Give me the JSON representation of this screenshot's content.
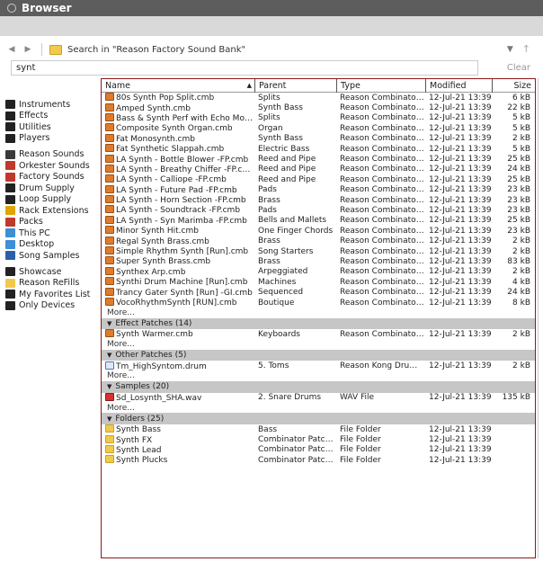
{
  "window": {
    "title": "Browser"
  },
  "nav": {
    "back_icon": "triangle-left-icon",
    "forward_icon": "triangle-right-icon",
    "search_scope": "Search in \"Reason Factory Sound Bank\"",
    "dropdown_icon": "triangle-down-icon",
    "up_icon": "arrow-up-icon"
  },
  "search": {
    "value": "synt",
    "clear_label": "Clear"
  },
  "sidebar": {
    "groups": [
      [
        {
          "label": "Instruments",
          "icon": "instruments-icon",
          "color": "#222222"
        },
        {
          "label": "Effects",
          "icon": "effects-icon",
          "color": "#222222"
        },
        {
          "label": "Utilities",
          "icon": "utilities-icon",
          "color": "#222222"
        },
        {
          "label": "Players",
          "icon": "players-icon",
          "color": "#222222"
        }
      ],
      [
        {
          "label": "Reason Sounds",
          "icon": "reason-sounds-icon",
          "color": "#3a3a3a"
        },
        {
          "label": "Orkester Sounds",
          "icon": "orkester-sounds-icon",
          "color": "#c0392b"
        },
        {
          "label": "Factory Sounds",
          "icon": "factory-sounds-icon",
          "color": "#c0392b"
        },
        {
          "label": "Drum Supply",
          "icon": "drum-supply-icon",
          "color": "#222222"
        },
        {
          "label": "Loop Supply",
          "icon": "loop-supply-icon",
          "color": "#222222"
        },
        {
          "label": "Rack Extensions",
          "icon": "rack-extensions-icon",
          "color": "#e0a400"
        },
        {
          "label": "Packs",
          "icon": "packs-icon",
          "color": "#c0392b"
        },
        {
          "label": "This PC",
          "icon": "this-pc-icon",
          "color": "#3d8fd6"
        },
        {
          "label": "Desktop",
          "icon": "desktop-icon",
          "color": "#3d8fd6"
        },
        {
          "label": "Song Samples",
          "icon": "song-samples-icon",
          "color": "#2b5fa8"
        }
      ],
      [
        {
          "label": "Showcase",
          "icon": "star-icon",
          "color": "#222222"
        },
        {
          "label": "Reason ReFills",
          "icon": "folder-icon",
          "color": "#f2c94c"
        },
        {
          "label": "My Favorites List",
          "icon": "star-icon",
          "color": "#222222"
        },
        {
          "label": "Only Devices",
          "icon": "star-icon",
          "color": "#222222"
        }
      ]
    ]
  },
  "columns": {
    "name": "Name",
    "parent": "Parent",
    "type": "Type",
    "modified": "Modified",
    "size": "Size"
  },
  "sections": [
    {
      "header": "",
      "rows": [
        {
          "icon": "comb",
          "name": "80s Synth Pop Split.cmb",
          "parent": "Splits",
          "type": "Reason Combinator ...",
          "modified": "12-Jul-21 13:39",
          "size": "6 kB"
        },
        {
          "icon": "comb",
          "name": "Amped Synth.cmb",
          "parent": "Synth Bass",
          "type": "Reason Combinator ...",
          "modified": "12-Jul-21 13:39",
          "size": "22 kB"
        },
        {
          "icon": "comb",
          "name": "Bass & Synth Perf with Echo Mod [...",
          "parent": "Splits",
          "type": "Reason Combinator ...",
          "modified": "12-Jul-21 13:39",
          "size": "5 kB"
        },
        {
          "icon": "comb",
          "name": "Composite Synth Organ.cmb",
          "parent": "Organ",
          "type": "Reason Combinator ...",
          "modified": "12-Jul-21 13:39",
          "size": "5 kB"
        },
        {
          "icon": "comb",
          "name": "Fat Monosynth.cmb",
          "parent": "Synth Bass",
          "type": "Reason Combinator ...",
          "modified": "12-Jul-21 13:39",
          "size": "2 kB"
        },
        {
          "icon": "comb",
          "name": "Fat Synthetic Slappah.cmb",
          "parent": "Electric Bass",
          "type": "Reason Combinator ...",
          "modified": "12-Jul-21 13:39",
          "size": "5 kB"
        },
        {
          "icon": "comb",
          "name": "LA Synth - Bottle Blower  -FP.cmb",
          "parent": "Reed and Pipe",
          "type": "Reason Combinator ...",
          "modified": "12-Jul-21 13:39",
          "size": "25 kB"
        },
        {
          "icon": "comb",
          "name": "LA Synth - Breathy Chiffer  -FP.cmb",
          "parent": "Reed and Pipe",
          "type": "Reason Combinator ...",
          "modified": "12-Jul-21 13:39",
          "size": "24 kB"
        },
        {
          "icon": "comb",
          "name": "LA Synth - Calliope  -FP.cmb",
          "parent": "Reed and Pipe",
          "type": "Reason Combinator ...",
          "modified": "12-Jul-21 13:39",
          "size": "25 kB"
        },
        {
          "icon": "comb",
          "name": "LA Synth - Future Pad  -FP.cmb",
          "parent": "Pads",
          "type": "Reason Combinator ...",
          "modified": "12-Jul-21 13:39",
          "size": "23 kB"
        },
        {
          "icon": "comb",
          "name": "LA Synth - Horn Section  -FP.cmb",
          "parent": "Brass",
          "type": "Reason Combinator ...",
          "modified": "12-Jul-21 13:39",
          "size": "23 kB"
        },
        {
          "icon": "comb",
          "name": "LA Synth - Soundtrack  -FP.cmb",
          "parent": "Pads",
          "type": "Reason Combinator ...",
          "modified": "12-Jul-21 13:39",
          "size": "23 kB"
        },
        {
          "icon": "comb",
          "name": "LA Synth - Syn Marimba  -FP.cmb",
          "parent": "Bells and Mallets",
          "type": "Reason Combinator ...",
          "modified": "12-Jul-21 13:39",
          "size": "25 kB"
        },
        {
          "icon": "comb",
          "name": "Minor Synth Hit.cmb",
          "parent": "One Finger Chords",
          "type": "Reason Combinator ...",
          "modified": "12-Jul-21 13:39",
          "size": "23 kB"
        },
        {
          "icon": "comb",
          "name": "Regal Synth Brass.cmb",
          "parent": "Brass",
          "type": "Reason Combinator ...",
          "modified": "12-Jul-21 13:39",
          "size": "2 kB"
        },
        {
          "icon": "comb",
          "name": "Simple Rhythm Synth [Run].cmb",
          "parent": "Song Starters",
          "type": "Reason Combinator ...",
          "modified": "12-Jul-21 13:39",
          "size": "2 kB"
        },
        {
          "icon": "comb",
          "name": "Super Synth Brass.cmb",
          "parent": "Brass",
          "type": "Reason Combinator ...",
          "modified": "12-Jul-21 13:39",
          "size": "83 kB"
        },
        {
          "icon": "comb",
          "name": "Synthex Arp.cmb",
          "parent": "Arpeggiated",
          "type": "Reason Combinator ...",
          "modified": "12-Jul-21 13:39",
          "size": "2 kB"
        },
        {
          "icon": "comb",
          "name": "Synthi Drum Machine [Run].cmb",
          "parent": "Machines",
          "type": "Reason Combinator ...",
          "modified": "12-Jul-21 13:39",
          "size": "4 kB"
        },
        {
          "icon": "comb",
          "name": "Trancy Gater Synth [Run]  -GI.cmb",
          "parent": "Sequenced",
          "type": "Reason Combinator ...",
          "modified": "12-Jul-21 13:39",
          "size": "24 kB"
        },
        {
          "icon": "comb",
          "name": "VocoRhythmSynth [RUN].cmb",
          "parent": "Boutique",
          "type": "Reason Combinator ...",
          "modified": "12-Jul-21 13:39",
          "size": "8 kB"
        }
      ],
      "more": "More..."
    },
    {
      "header": "Effect Patches (14)",
      "rows": [
        {
          "icon": "comb",
          "name": "Synth Warmer.cmb",
          "parent": "Keyboards",
          "type": "Reason Combinator ...",
          "modified": "12-Jul-21 13:39",
          "size": "2 kB"
        }
      ],
      "more": "More..."
    },
    {
      "header": "Other Patches (5)",
      "rows": [
        {
          "icon": "drum",
          "name": "Tm_HighSyntom.drum",
          "parent": "5. Toms",
          "type": "Reason Kong Drum ...",
          "modified": "12-Jul-21 13:39",
          "size": "2 kB"
        }
      ],
      "more": "More..."
    },
    {
      "header": "Samples (20)",
      "rows": [
        {
          "icon": "wav",
          "name": "Sd_Losynth_SHA.wav",
          "parent": "2. Snare Drums",
          "type": "WAV File",
          "modified": "12-Jul-21 13:39",
          "size": "135 kB"
        }
      ],
      "more": "More..."
    },
    {
      "header": "Folders (25)",
      "rows": [
        {
          "icon": "fold",
          "name": "Synth Bass",
          "parent": "Bass",
          "type": "File Folder",
          "modified": "12-Jul-21 13:39",
          "size": ""
        },
        {
          "icon": "fold",
          "name": "Synth FX",
          "parent": "Combinator Patch...",
          "type": "File Folder",
          "modified": "12-Jul-21 13:39",
          "size": ""
        },
        {
          "icon": "fold",
          "name": "Synth Lead",
          "parent": "Combinator Patch...",
          "type": "File Folder",
          "modified": "12-Jul-21 13:39",
          "size": ""
        },
        {
          "icon": "fold",
          "name": "Synth Plucks",
          "parent": "Combinator Patch...",
          "type": "File Folder",
          "modified": "12-Jul-21 13:39",
          "size": ""
        }
      ],
      "more": ""
    }
  ]
}
